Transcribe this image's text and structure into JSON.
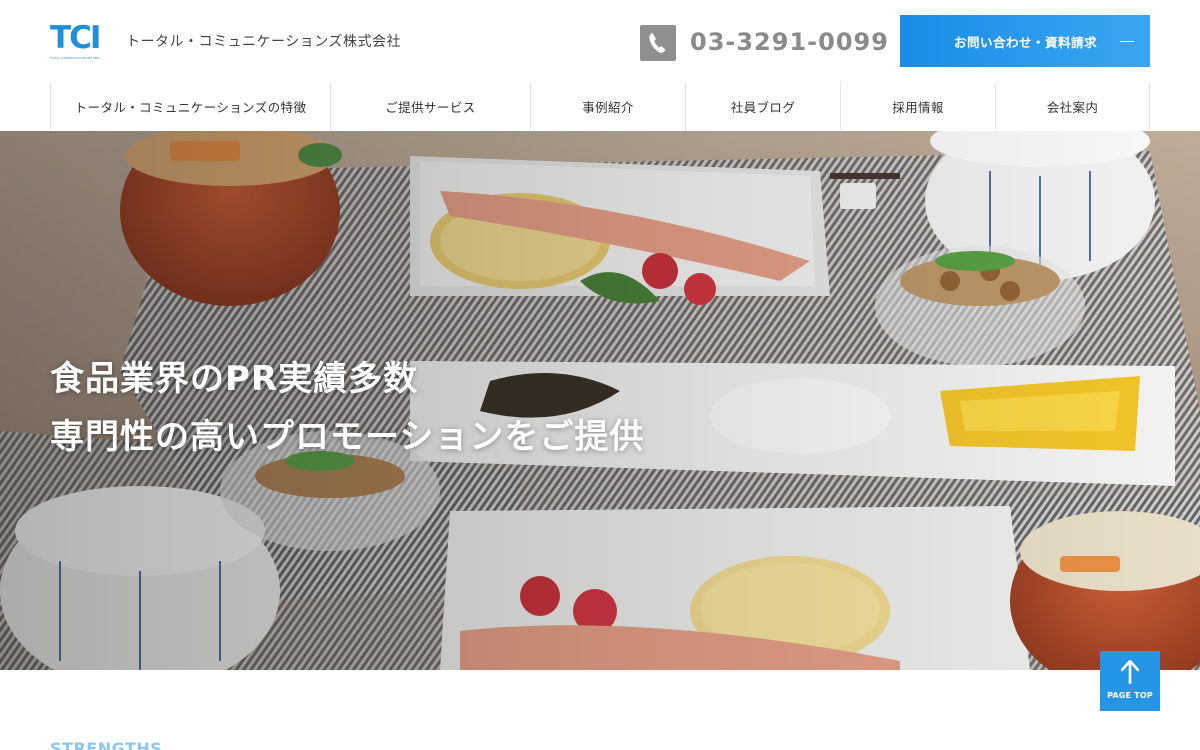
{
  "header": {
    "logo_text": "TCI",
    "logo_subtext": "TOTAL COMMUNICATIONS INC.",
    "company_name": "トータル・コミュニケーションズ株式会社",
    "phone_number": "03-3291-0099",
    "contact_button_label": "お問い合わせ・資料請求"
  },
  "nav": {
    "items": [
      {
        "label": "トータル・コミュニケーションズの特徴"
      },
      {
        "label": "ご提供サービス"
      },
      {
        "label": "事例紹介"
      },
      {
        "label": "社員ブログ"
      },
      {
        "label": "採用情報"
      },
      {
        "label": "会社案内"
      }
    ]
  },
  "hero": {
    "line1": "食品業界のPR実績多数",
    "line2": "専門性の高いプロモーションをご提供"
  },
  "page_top": {
    "label": "PAGE TOP"
  },
  "section": {
    "heading": "STRENGTHS"
  },
  "colors": {
    "accent": "#1f8fd8",
    "button_gradient_start": "#1a8ce6",
    "button_gradient_end": "#3ba6f2",
    "phone_gray": "#8a8a8a"
  },
  "icons": {
    "phone": "phone-icon",
    "arrow_up": "arrow-up-icon"
  }
}
